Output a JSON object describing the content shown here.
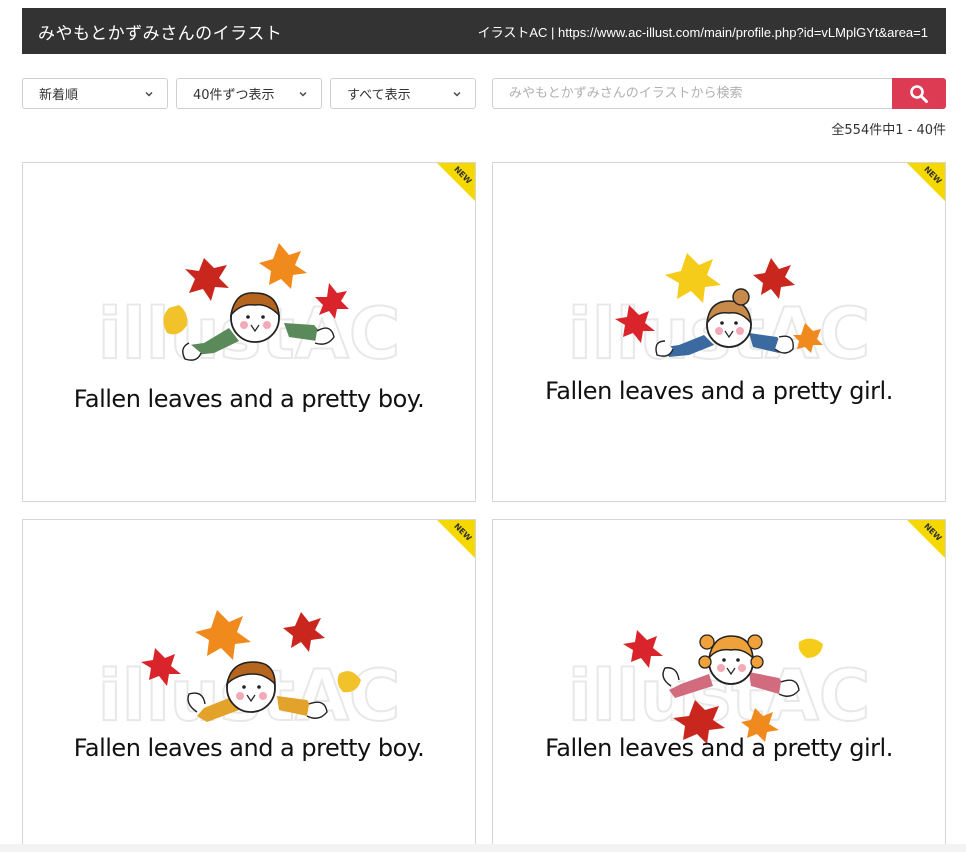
{
  "header": {
    "title": "みやもとかずみさんのイラスト",
    "source": "イラストAC | https://www.ac-illust.com/main/profile.php?id=vLMplGYt&area=1"
  },
  "controls": {
    "sort_label": "新着順",
    "per_page_label": "40件ずつ表示",
    "filter_label": "すべて表示",
    "search_placeholder": "みやもとかずみさんのイラストから検索"
  },
  "results": {
    "count_text": "全554件中1 - 40件"
  },
  "colors": {
    "header_bg": "#333333",
    "search_button": "#dc3b53",
    "new_badge": "#f5d800"
  },
  "cards": [
    {
      "badge": "NEW",
      "caption": "Fallen leaves and a pretty boy.",
      "watermark": "illustAC"
    },
    {
      "badge": "NEW",
      "caption": "Fallen leaves and a pretty girl.",
      "watermark": "illustAC"
    },
    {
      "badge": "NEW",
      "caption": "Fallen leaves and a pretty boy.",
      "watermark": "illustAC"
    },
    {
      "badge": "NEW",
      "caption": "Fallen leaves and a pretty girl.",
      "watermark": "illustAC"
    }
  ]
}
